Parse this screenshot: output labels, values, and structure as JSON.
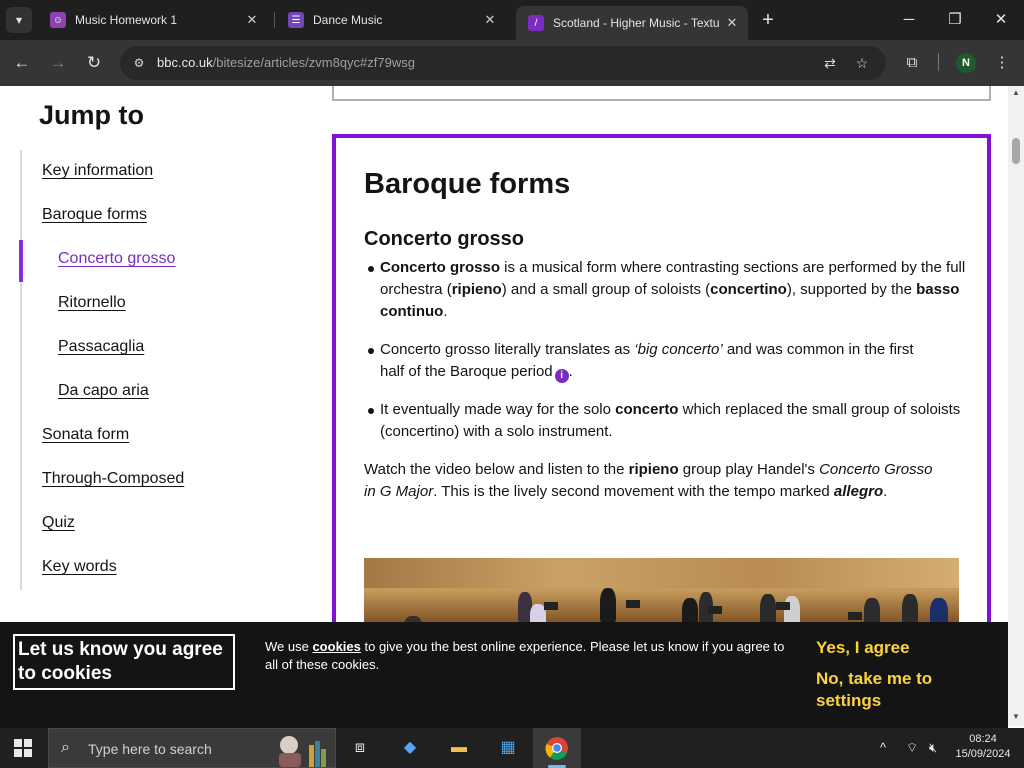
{
  "browser": {
    "tabs": [
      {
        "title": "Music Homework 1",
        "favicon_color": "#8e44ad",
        "favicon_glyph": "☺"
      },
      {
        "title": "Dance Music",
        "favicon_color": "#7248b9",
        "favicon_glyph": "☰"
      },
      {
        "title": "Scotland - Higher Music - Textu",
        "favicon_color": "#7b2cbf",
        "favicon_glyph": "/"
      }
    ],
    "url_host": "bbc.co.uk",
    "url_path": "/bitesize/articles/zvm8qyc#zf79wsg",
    "profile_initial": "N"
  },
  "sidebar": {
    "title": "Jump to",
    "items": [
      {
        "label": "Key information",
        "indent": false,
        "active": false
      },
      {
        "label": "Baroque forms",
        "indent": false,
        "active": false
      },
      {
        "label": "Concerto grosso",
        "indent": true,
        "active": true
      },
      {
        "label": "Ritornello",
        "indent": true,
        "active": false
      },
      {
        "label": "Passacaglia",
        "indent": true,
        "active": false
      },
      {
        "label": "Da capo aria",
        "indent": true,
        "active": false
      },
      {
        "label": "Sonata form",
        "indent": false,
        "active": false
      },
      {
        "label": "Through-Composed",
        "indent": false,
        "active": false
      },
      {
        "label": "Quiz",
        "indent": false,
        "active": false
      },
      {
        "label": "Key words",
        "indent": false,
        "active": false
      }
    ]
  },
  "article": {
    "heading": "Baroque forms",
    "subheading": "Concerto grosso",
    "bullets": [
      {
        "segments": [
          {
            "text": "Concerto grosso",
            "style": "bold"
          },
          {
            "text": " is a musical form where contrasting sections are performed by the full orchestra (",
            "style": "normal"
          },
          {
            "text": "ripieno",
            "style": "bold"
          },
          {
            "text": ") and a small group of soloists (",
            "style": "normal"
          },
          {
            "text": "concertino",
            "style": "bold"
          },
          {
            "text": "), supported by the ",
            "style": "normal"
          },
          {
            "text": "basso continuo",
            "style": "bold"
          },
          {
            "text": ".",
            "style": "normal"
          }
        ]
      },
      {
        "segments": [
          {
            "text": "Concerto grosso literally translates as ",
            "style": "normal"
          },
          {
            "text": "‘big concerto’",
            "style": "italic"
          },
          {
            "text": " and was common in the first half of the Baroque period",
            "style": "normal"
          },
          {
            "text": "i",
            "style": "info"
          },
          {
            "text": ".",
            "style": "normal"
          }
        ]
      },
      {
        "segments": [
          {
            "text": "It eventually made way for the solo ",
            "style": "normal"
          },
          {
            "text": "concerto",
            "style": "bold"
          },
          {
            "text": " which replaced the small group of soloists (concertino) with a solo instrument.",
            "style": "normal"
          }
        ]
      }
    ],
    "paragraph": [
      {
        "text": "Watch the video below and listen to the ",
        "style": "normal"
      },
      {
        "text": "ripieno",
        "style": "bold"
      },
      {
        "text": " group play Handel's ",
        "style": "normal"
      },
      {
        "text": "Concerto Grosso in G Major",
        "style": "italic"
      },
      {
        "text": ". This is the lively second movement with the tempo marked ",
        "style": "normal"
      },
      {
        "text": "allegro",
        "style": "bolditalic"
      },
      {
        "text": ".",
        "style": "normal"
      }
    ]
  },
  "cookie_banner": {
    "title": "Let us know you agree to cookies",
    "text_before": "We use ",
    "link": "cookies",
    "text_after": " to give you the best online experience. Please let us know if you agree to all of these cookies.",
    "accept": "Yes, I agree",
    "settings": "No, take me to settings"
  },
  "taskbar": {
    "search_placeholder": "Type here to search",
    "time": "08:24",
    "date": "15/09/2024"
  },
  "colors": {
    "accent_purple": "#7f12d6",
    "cookie_button": "#fdd33a",
    "chrome_dark": "#1f1f1f"
  }
}
